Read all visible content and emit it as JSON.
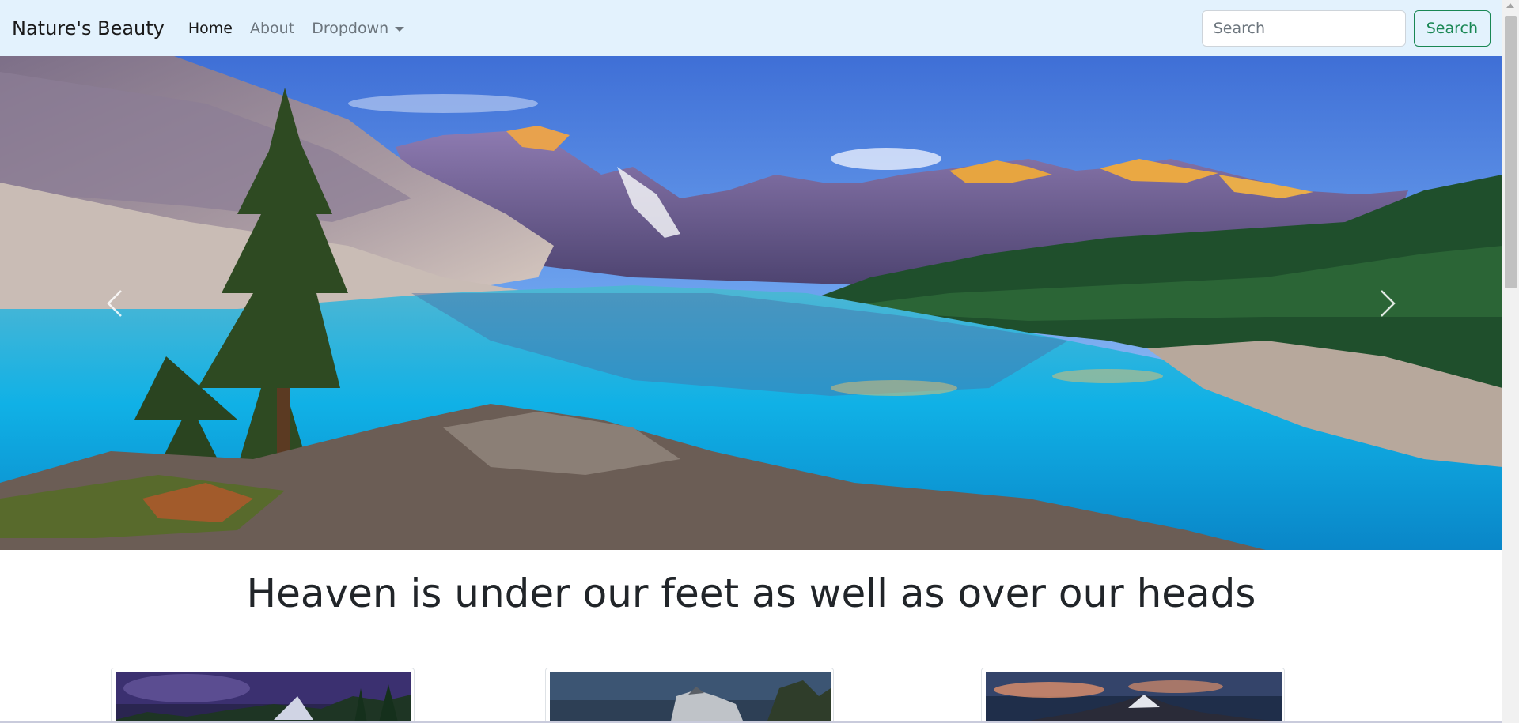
{
  "navbar": {
    "brand": "Nature's Beauty",
    "links": [
      {
        "label": "Home",
        "active": true
      },
      {
        "label": "About",
        "active": false
      },
      {
        "label": "Dropdown",
        "active": false
      }
    ],
    "search": {
      "placeholder": "Search",
      "button_label": "Search"
    }
  },
  "hero": {
    "image": "mountain-lake-landscape",
    "prev_icon": "chevron-left-icon",
    "next_icon": "chevron-right-icon"
  },
  "main": {
    "headline": "Heaven is under our feet as well as over our heads"
  },
  "cards": [
    {
      "image": "stormy-mountain-forest"
    },
    {
      "image": "rock-formation-shore"
    },
    {
      "image": "sunset-mountain-peak"
    }
  ],
  "colors": {
    "navbar_bg": "#e3f2fd",
    "search_accent": "#198754"
  }
}
